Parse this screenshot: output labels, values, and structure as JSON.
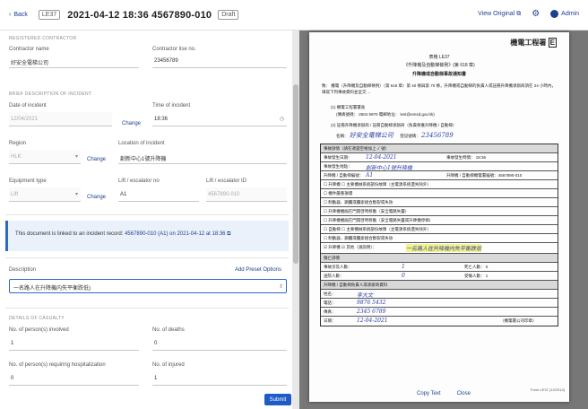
{
  "header": {
    "back_label": "Back",
    "ref_tag": "LE37",
    "title": "2021-04-12  18:36  4567890-010",
    "status": "Draft",
    "view_original": "View Original",
    "user": "Admin"
  },
  "form": {
    "section_contractor": "REGISTERED CONTRACTOR",
    "contractor_name_label": "Contractor name",
    "contractor_name": "好安全電梯公司",
    "contractor_no_label": "Contractor lise no.",
    "contractor_no": "23456789",
    "section_incident": "BRIEF DESCRIPTION OF INCIDENT",
    "date_label": "Date of incident",
    "date_value": "12/04/2021",
    "time_label": "Time of incident",
    "time_value": "18:36",
    "change_label": "Change",
    "region_label": "Region",
    "region_value": "HLK",
    "location_label": "Location of incident",
    "location_value": "創新中心1號升降機",
    "equipment_label": "Equipment type",
    "equipment_value": "Lift",
    "lift_no_label": "Lift / escalator no",
    "lift_no_value": "A1",
    "lift_id_label": "Lift / escalator ID",
    "lift_id_value": "4567890-010",
    "banner_text": "This document is linked to an incident record:",
    "banner_link": "4567890-010 (A1) on 2021-04-12 at 18:36",
    "description_label": "Description",
    "add_preset": "Add Preset Options",
    "description_value": "一名路人在升降機内失平衡跌低)",
    "section_casualty": "DETAILS OF CASUALTY",
    "persons_involved_label": "No. of person(s) involved",
    "persons_involved": "1",
    "deaths_label": "No. of deaths",
    "deaths": "0",
    "hospital_label": "No. of person(s) requiring hospitalization",
    "hospital": "0",
    "injured_label": "No. of injured",
    "injured": "1",
    "submit_label": "Submit"
  },
  "document": {
    "dept_header": "機電工程署",
    "ref": "表格 LE37",
    "ordinance": "《升降機及自動梯條例》(第 618 章)",
    "form_title": "升降機或自動梯事故通知書",
    "intro": "致：  機電（升降機及自動梯條例）（第 618 章）第 40 條與第 70 條，升降機或自動梯的負責人或註冊升降機承辦商須在 24 小時內，填寫下列事故資料並呈交 ...",
    "to_line": "(1) 機電工程署署長",
    "fax_line": "(傳真號碼： 2504 5970  電郵地址： lest@emsd.gov.hk)",
    "contractor_line": "(2) 註冊升降機承辦商 / 註冊自動梯承辦商（負責保養升降機 / 自動梯）",
    "name_label": "名稱：",
    "name_hand": "好安全電梯公司",
    "reg_label": "登記號碼：",
    "reg_hand": "23456789",
    "rows": [
      {
        "a": "事故詳情（請在適當空格加上 ✓ 號）",
        "b": "",
        "c": ""
      },
      {
        "a": "事故發生日期：",
        "b": "12-04-2021",
        "c": "事故發生時間：  18:36"
      },
      {
        "a": "事故發生地點：",
        "b": "創新中心1號升降機",
        "c": ""
      },
      {
        "a": "升降機 / 自動梯編號：",
        "b": "A1",
        "c": "升降機 / 自動梯機電署編號：4567890-010"
      },
      {
        "a": "☐ 升降機   ☐ 主要機械系統部份故障（主電源系統遺失除外）",
        "b": "",
        "c": ""
      },
      {
        "a": "           ☐ 機件嚴重損壞",
        "b": "",
        "c": ""
      },
      {
        "a": "           ☐ 制動器、鋼纜或纜索組合斷裂或失效",
        "b": "",
        "c": ""
      },
      {
        "a": "           ☐ 升降機機廂在門開啓時移動（安全電路失靈）",
        "b": "",
        "c": ""
      },
      {
        "a": "           ☐ 升降機機廂在門開啓時移動（安全電路失靈或升降機停頓）",
        "b": "",
        "c": ""
      },
      {
        "a": "☐ 自動梯   ☐ 主要機械系統部份故障（主電源系統遺失除外）",
        "b": "",
        "c": ""
      },
      {
        "a": "           ☐ 制動器、鋼纜或纜索組合斷裂或失效",
        "b": "",
        "c": ""
      },
      {
        "a": "☑ 升降機   ☑ 其他（請說明）：",
        "b": "一名路人在升降機内失平衡跌低",
        "c": ""
      },
      {
        "a": "傷亡詳情",
        "b": "",
        "c": ""
      },
      {
        "a": "事故涉及人數：",
        "b": "1",
        "c": "死亡人數：  0"
      },
      {
        "a": "送院人數：",
        "b": "0",
        "c": "受傷人數：  1"
      },
      {
        "a": "升降機 / 自動梯負責人或承辦商資料",
        "b": "",
        "c": ""
      },
      {
        "a": "姓名：",
        "b": "李大文",
        "c": ""
      },
      {
        "a": "電話：",
        "b": "9876 5432",
        "c": ""
      },
      {
        "a": "傳真：",
        "b": "2345 6789",
        "c": ""
      },
      {
        "a": "日期：",
        "b": "12-04-2021",
        "c": "（機電署公司印章）"
      }
    ],
    "copy_text": "Copy Text",
    "close": "Close",
    "footer_ref": "Form LE37 (12/2013)"
  },
  "colors": {
    "accent": "#1e5bc6",
    "link": "#1e3f8f",
    "handwriting": "#2b3fa8",
    "highlight": "#f4f28a"
  }
}
